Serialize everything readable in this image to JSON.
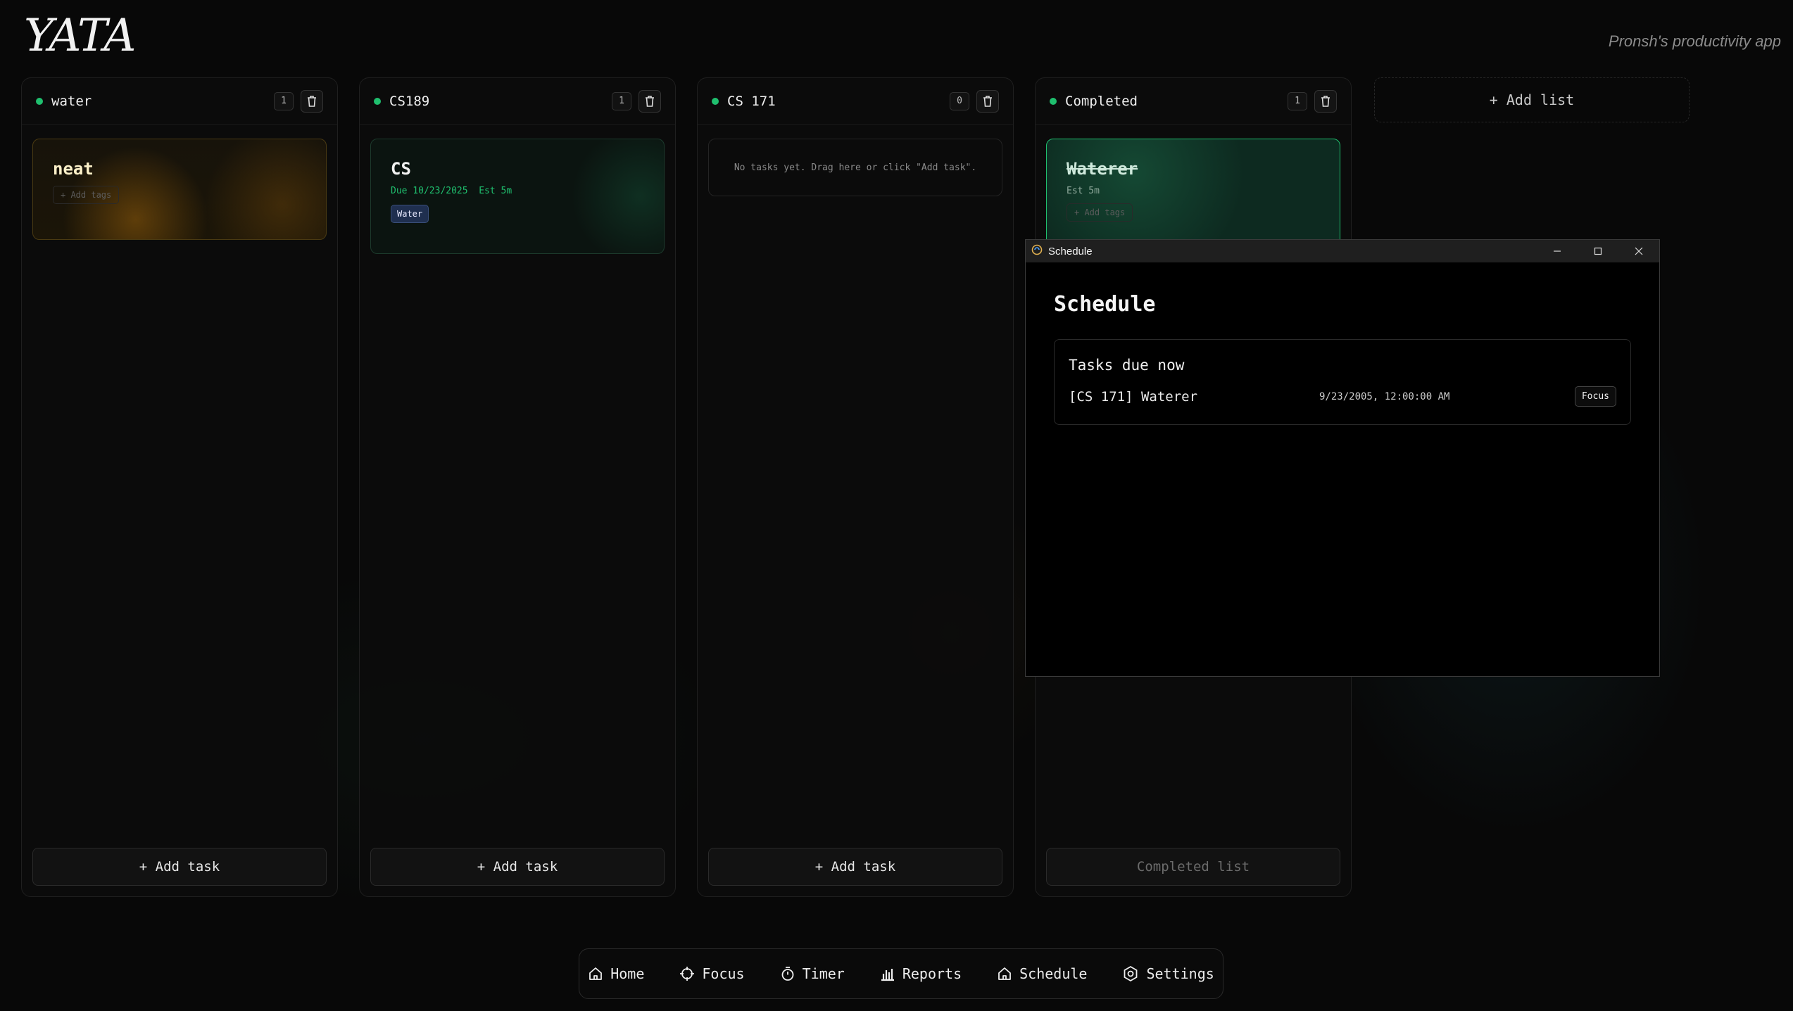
{
  "app": {
    "logo": "YATA",
    "tagline": "Pronsh's productivity app"
  },
  "colors": {
    "accent_green": "#1fbf6e",
    "background": "#080808",
    "card_orange": "#4a3a12",
    "tag_blue": "#1f2f4f"
  },
  "lists": [
    {
      "title": "water",
      "count": "1",
      "add_label": "+ Add task",
      "card": {
        "title": "neat",
        "add_tags": "+ Add tags"
      }
    },
    {
      "title": "CS189",
      "count": "1",
      "add_label": "+ Add task",
      "card": {
        "title": "CS",
        "due": "Due 10/23/2025",
        "est": "Est 5m",
        "tag": "Water"
      }
    },
    {
      "title": "CS 171",
      "count": "0",
      "add_label": "+ Add task",
      "empty_text": "No tasks yet. Drag here or click \"Add task\"."
    },
    {
      "title": "Completed",
      "count": "1",
      "add_label": "Completed list",
      "card": {
        "title": "Waterer",
        "est": "Est 5m",
        "add_tags": "+ Add tags"
      }
    }
  ],
  "add_list_label": "+ Add list",
  "schedule_window": {
    "window_title": "Schedule",
    "heading": "Schedule",
    "section_title": "Tasks due now",
    "items": [
      {
        "task": "[CS 171] Waterer",
        "time": "9/23/2005, 12:00:00 AM",
        "action": "Focus"
      }
    ]
  },
  "nav": [
    {
      "label": "Home",
      "icon": "home-icon"
    },
    {
      "label": "Focus",
      "icon": "crosshair-icon"
    },
    {
      "label": "Timer",
      "icon": "stopwatch-icon"
    },
    {
      "label": "Reports",
      "icon": "bar-chart-icon"
    },
    {
      "label": "Schedule",
      "icon": "home-icon"
    },
    {
      "label": "Settings",
      "icon": "hexagon-gear-icon"
    }
  ]
}
